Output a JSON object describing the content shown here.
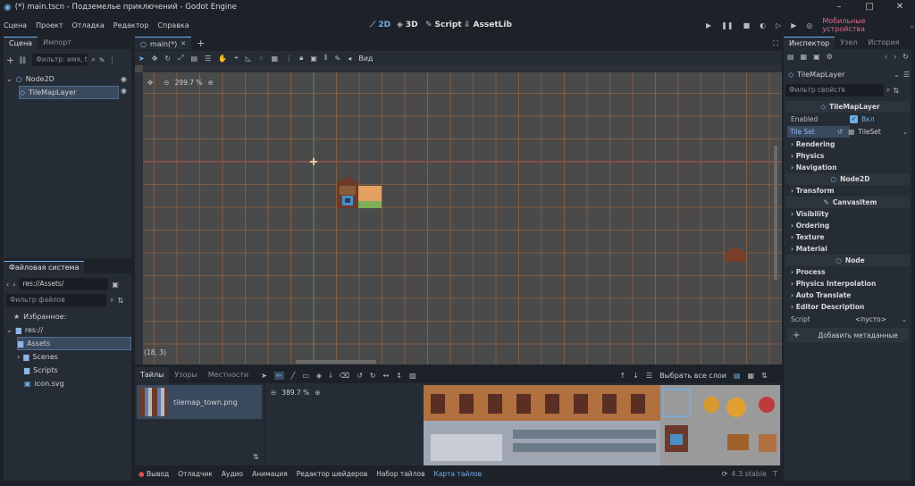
{
  "window": {
    "title": "(*) main.tscn - Подземелье приключений - Godot Engine"
  },
  "menu": [
    "Сцена",
    "Проект",
    "Отладка",
    "Редактор",
    "Справка"
  ],
  "modes": [
    {
      "label": "2D",
      "active": true
    },
    {
      "label": "3D",
      "active": false
    },
    {
      "label": "Script",
      "active": false
    },
    {
      "label": "AssetLib",
      "active": false
    }
  ],
  "renderer": "Мобильные устройства",
  "scene_dock": {
    "tabs": [
      "Сцена",
      "Импорт"
    ],
    "filter_placeholder": "Фильтр: имя, t",
    "nodes": [
      {
        "name": "Node2D",
        "type": "root"
      },
      {
        "name": "TileMapLayer",
        "type": "child",
        "selected": true
      }
    ]
  },
  "fs_dock": {
    "title": "Файловая система",
    "path": "res://Assets/",
    "filter_placeholder": "Фильтр файлов",
    "favorites": "Избранное:",
    "root": "res://",
    "items": [
      "Assets",
      "Scenes",
      "Scripts",
      "icon.svg"
    ]
  },
  "editor_tab": "main(*)",
  "toolbar": {
    "view": "Вид"
  },
  "viewport": {
    "zoom": "299.7 %",
    "coords": "(18, 3)"
  },
  "tile_editor": {
    "tabs": [
      "Тайлы",
      "Узоры",
      "Местности"
    ],
    "select_all_layers": "Выбрать все слои",
    "source": "tilemap_town.png",
    "zoom": "389.7 %"
  },
  "bottom_panel": {
    "tabs": [
      "Вывод",
      "Отладчик",
      "Аудио",
      "Анимация",
      "Редактор шейдеров",
      "Набор тайлов",
      "Карта тайлов"
    ],
    "active": "Карта тайлов",
    "version": "4.3.stable"
  },
  "inspector": {
    "tabs": [
      "Инспектор",
      "Узел",
      "История"
    ],
    "object": "TileMapLayer",
    "filter_placeholder": "Фильтр свойств",
    "class_tilemaplayer": "TileMapLayer",
    "enabled_label": "Enabled",
    "enabled_value": "Вкл",
    "tileset_label": "Tile Set",
    "tileset_value": "TileSet",
    "groups_tml": [
      "Rendering",
      "Physics",
      "Navigation"
    ],
    "class_node2d": "Node2D",
    "groups_n2d": [
      "Transform"
    ],
    "class_canvas": "CanvasItem",
    "groups_canvas": [
      "Visibility",
      "Ordering",
      "Texture",
      "Material"
    ],
    "class_node": "Node",
    "groups_node": [
      "Process",
      "Physics Interpolation",
      "Auto Translate",
      "Editor Description"
    ],
    "script_label": "Script",
    "script_value": "<пусто>",
    "add_meta": "Добавить метаданные"
  },
  "colors": {
    "accent": "#6fb0ea",
    "bg": "#1d2229",
    "panel": "#262c35",
    "viewport": "#4a4a4a",
    "grid": "#c8753a",
    "mobile": "#e06a8f"
  }
}
